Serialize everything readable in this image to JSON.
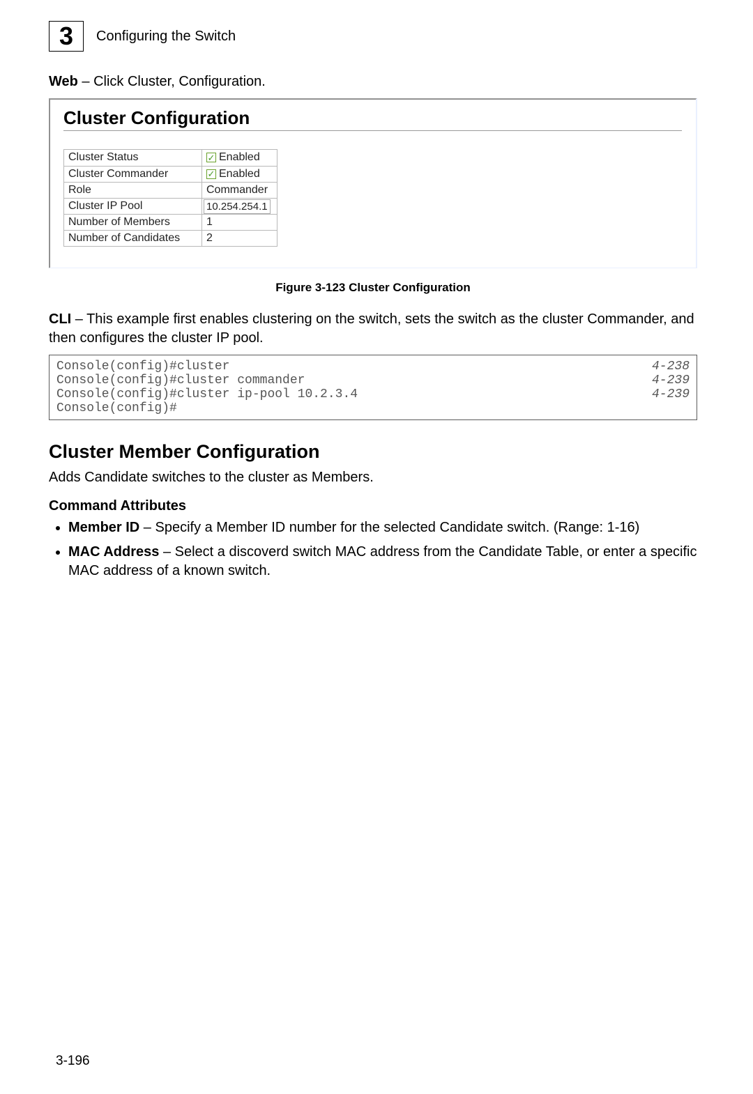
{
  "header": {
    "chapter_number": "3",
    "chapter_title": "Configuring the Switch"
  },
  "web_label": "Web",
  "web_text": " – Click Cluster, Configuration.",
  "screenshot": {
    "title": "Cluster Configuration",
    "rows": {
      "cluster_status_label": "Cluster Status",
      "cluster_status_checkbox_label": "Enabled",
      "cluster_commander_label": "Cluster Commander",
      "cluster_commander_checkbox_label": "Enabled",
      "role_label": "Role",
      "role_value": "Commander",
      "ip_pool_label": "Cluster IP Pool",
      "ip_pool_value": "10.254.254.1",
      "members_label": "Number of Members",
      "members_value": "1",
      "candidates_label": "Number of Candidates",
      "candidates_value": "2"
    }
  },
  "figure_caption": "Figure 3-123  Cluster Configuration",
  "cli_label": "CLI",
  "cli_text": " – This example first enables clustering on the switch, sets the switch as the cluster Commander, and then configures the cluster IP pool.",
  "cli": {
    "line1": "Console(config)#cluster",
    "ref1": "4-238",
    "line2": "Console(config)#cluster commander",
    "ref2": "4-239",
    "line3": "Console(config)#cluster ip-pool 10.2.3.4",
    "ref3": "4-239",
    "line4": "Console(config)#"
  },
  "section2_title": "Cluster Member Configuration",
  "section2_intro": "Adds Candidate switches to the cluster as Members.",
  "command_attributes_title": "Command Attributes",
  "bullets": {
    "b1_bold": "Member ID",
    "b1_rest": " – Specify a Member ID number for the selected Candidate switch. (Range: 1-16)",
    "b2_bold": "MAC Address",
    "b2_rest": " – Select a discoverd switch MAC address from the Candidate Table, or enter a specific MAC address of a known switch."
  },
  "page_number": "3-196"
}
